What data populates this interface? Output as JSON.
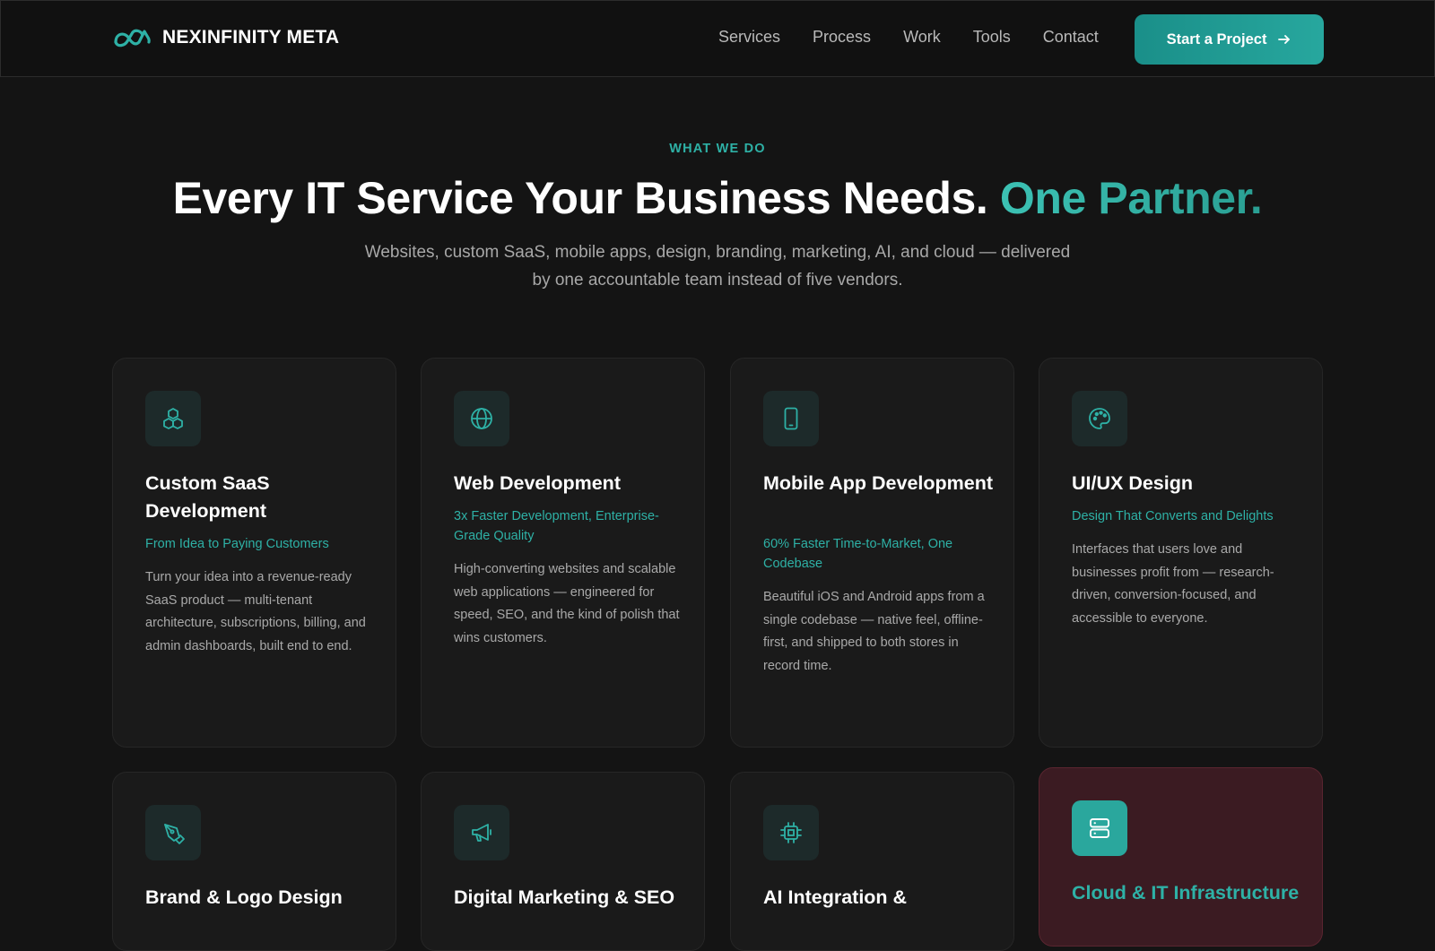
{
  "header": {
    "brand_name": "NEXINFINITY META",
    "nav": [
      "Services",
      "Process",
      "Work",
      "Tools",
      "Contact"
    ],
    "cta_label": "Start a Project",
    "accent_color": "#27a79e"
  },
  "hero": {
    "eyebrow": "WHAT WE DO",
    "headline_main": "Every IT Service Your Business Needs. ",
    "headline_accent": "One Partner.",
    "subhead": "Websites, custom SaaS, mobile apps, design, branding, marketing, AI, and cloud — delivered by one accountable team instead of five vendors."
  },
  "services": [
    {
      "icon": "cubes-icon",
      "title": "Custom SaaS Development",
      "tagline": "From Idea to Paying Customers",
      "description": "Turn your idea into a revenue-ready SaaS product — multi-tenant architecture, subscriptions, billing, and admin dashboards, built end to end."
    },
    {
      "icon": "globe-icon",
      "title": "Web Development",
      "tagline": "3x Faster Development, Enterprise-Grade Quality",
      "description": "High-converting websites and scalable web applications — engineered for speed, SEO, and the kind of polish that wins customers."
    },
    {
      "icon": "tablet-icon",
      "title": "Mobile App Development",
      "tagline": "60% Faster Time-to-Market, One Codebase",
      "description": "Beautiful iOS and Android apps from a single codebase — native feel, offline-first, and shipped to both stores in record time."
    },
    {
      "icon": "palette-icon",
      "title": "UI/UX Design",
      "tagline": "Design That Converts and Delights",
      "description": "Interfaces that users love and businesses profit from — research-driven, conversion-focused, and accessible to everyone."
    },
    {
      "icon": "pen-tool-icon",
      "title": "Brand & Logo Design"
    },
    {
      "icon": "megaphone-icon",
      "title": "Digital Marketing & SEO"
    },
    {
      "icon": "cpu-chip-icon",
      "title": "AI Integration &"
    },
    {
      "icon": "server-icon",
      "title": "Cloud & IT Infrastructure"
    }
  ]
}
